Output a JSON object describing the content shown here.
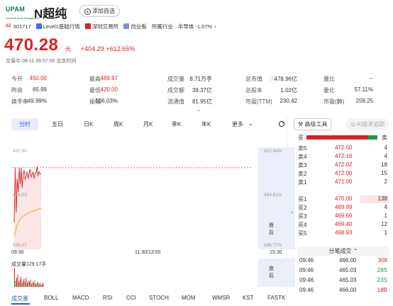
{
  "header": {
    "logo_text": "UPAM",
    "logo_sub": "Universal Asset Management",
    "stock_name": "N超纯",
    "add_watchlist_label": "添加自选",
    "exchange_badge": "SZ",
    "code": "301717",
    "level_label": "Level1基础行情",
    "exchange": "深圳交易所",
    "board": "创业板",
    "industry_label": "所属行业",
    "industry": "半导体 -1.07%",
    "chevron": "›"
  },
  "quote": {
    "price": "470.28",
    "unit": "元",
    "change": "+404.29",
    "change_pct": "+612.65%",
    "status": "交易中 08-11 09:57:00 北京时间"
  },
  "stats": {
    "rows": [
      [
        {
          "l": "今开",
          "v": "450.00",
          "c": "red"
        },
        {
          "l": "最高",
          "v": "489.97",
          "c": "red"
        },
        {
          "l": "成交量",
          "v": "8.71万手",
          "c": ""
        },
        {
          "l": "总市值",
          "v": "478.96亿",
          "c": "",
          "i": true
        },
        {
          "l": "量比",
          "v": "--",
          "c": ""
        }
      ],
      [
        {
          "l": "昨收",
          "v": "65.99",
          "c": ""
        },
        {
          "l": "最低",
          "v": "420.00",
          "c": "red"
        },
        {
          "l": "成交额",
          "v": "39.37亿",
          "c": ""
        },
        {
          "l": "总股本",
          "v": "1.02亿",
          "c": ""
        },
        {
          "l": "委比",
          "v": "57.11%",
          "c": ""
        }
      ],
      [
        {
          "l": "换手率",
          "v": "49.99%",
          "c": ""
        },
        {
          "l": "振幅",
          "v": "106.03%",
          "c": ""
        },
        {
          "l": "流通值",
          "v": "81.95亿",
          "c": ""
        },
        {
          "l": "市盈(TTM)",
          "v": "230.42",
          "c": ""
        },
        {
          "l": "市盈(静)",
          "v": "259.25",
          "c": ""
        }
      ]
    ],
    "expand_icon": "chevron-down"
  },
  "kline_tabs": [
    "分时",
    "五日",
    "日K",
    "周K",
    "月K",
    "季K",
    "年K",
    "更多"
  ],
  "tools": {
    "advanced_label": "高级工具",
    "ai_label": "AI技术追踪"
  },
  "chart_data": {
    "type": "line",
    "title": "分时",
    "y_labels_left": [
      "437.00",
      "419.03",
      "539.07"
    ],
    "y_labels_right": [
      "622.84%",
      "594.81%",
      "586.77%"
    ],
    "x_labels": [
      "09:30",
      "11:30/13:00",
      "15:30"
    ],
    "reference_price": "470.00",
    "series": [
      {
        "name": "价格",
        "color": "#e02020",
        "values": [
          430,
          470,
          437,
          462,
          452,
          470,
          458,
          470,
          455,
          466,
          468,
          461,
          464,
          467,
          462,
          466,
          469,
          463,
          465,
          467,
          462,
          466,
          466,
          471,
          464,
          467,
          466,
          465
        ]
      },
      {
        "name": "均价",
        "color": "#f0a020",
        "values": [
          420,
          422,
          425,
          428,
          430,
          431,
          432,
          433,
          434,
          434,
          435,
          435,
          436,
          436,
          437,
          437,
          437,
          438,
          438,
          438,
          438,
          439,
          439,
          439,
          439,
          440,
          440,
          440
        ]
      }
    ],
    "ylim": [
      410,
      485
    ],
    "volume_label": "成交量129.17手",
    "volume": [
      18,
      6,
      9,
      12,
      5,
      7,
      10,
      4,
      6,
      8,
      5,
      9,
      4,
      6,
      5,
      7,
      3,
      5,
      4,
      6,
      3,
      4,
      5,
      3,
      4,
      2,
      3,
      4
    ]
  },
  "side_labels": {
    "upper": "盘\n后",
    "lower": "盘\n后"
  },
  "indicators": [
    "成交量",
    "BOLL",
    "MACD",
    "RSI",
    "CCI",
    "STOCH",
    "MOM",
    "WMSR",
    "KST",
    "FASTK"
  ],
  "order_book": {
    "buy_side_label": "买",
    "sell_side_label": "卖",
    "buy_ratio": 0.87,
    "asks": [
      {
        "label": "卖5",
        "price": "472.50",
        "vol": "4"
      },
      {
        "label": "卖4",
        "price": "472.16",
        "vol": "4"
      },
      {
        "label": "卖3",
        "price": "472.02",
        "vol": "18"
      },
      {
        "label": "卖2",
        "price": "472.00",
        "vol": "15"
      },
      {
        "label": "卖1",
        "price": "471.00",
        "vol": "2"
      }
    ],
    "bids": [
      {
        "label": "买1",
        "price": "470.00",
        "vol": "138"
      },
      {
        "label": "买2",
        "price": "469.99",
        "vol": "4"
      },
      {
        "label": "买3",
        "price": "469.60",
        "vol": "1"
      },
      {
        "label": "买4",
        "price": "469.40",
        "vol": "12"
      },
      {
        "label": "买5",
        "price": "468.93",
        "vol": "1"
      }
    ]
  },
  "trades": {
    "title": "分笔成交",
    "rows": [
      {
        "t": "09:46",
        "p": "466.00",
        "v": "308",
        "d": "red"
      },
      {
        "t": "09:46",
        "p": "465.03",
        "v": "28S",
        "d": "green"
      },
      {
        "t": "09:46",
        "p": "465.03",
        "v": "23S",
        "d": "green"
      },
      {
        "t": "09:46",
        "p": "466.00",
        "v": "18B",
        "d": "red"
      }
    ]
  }
}
